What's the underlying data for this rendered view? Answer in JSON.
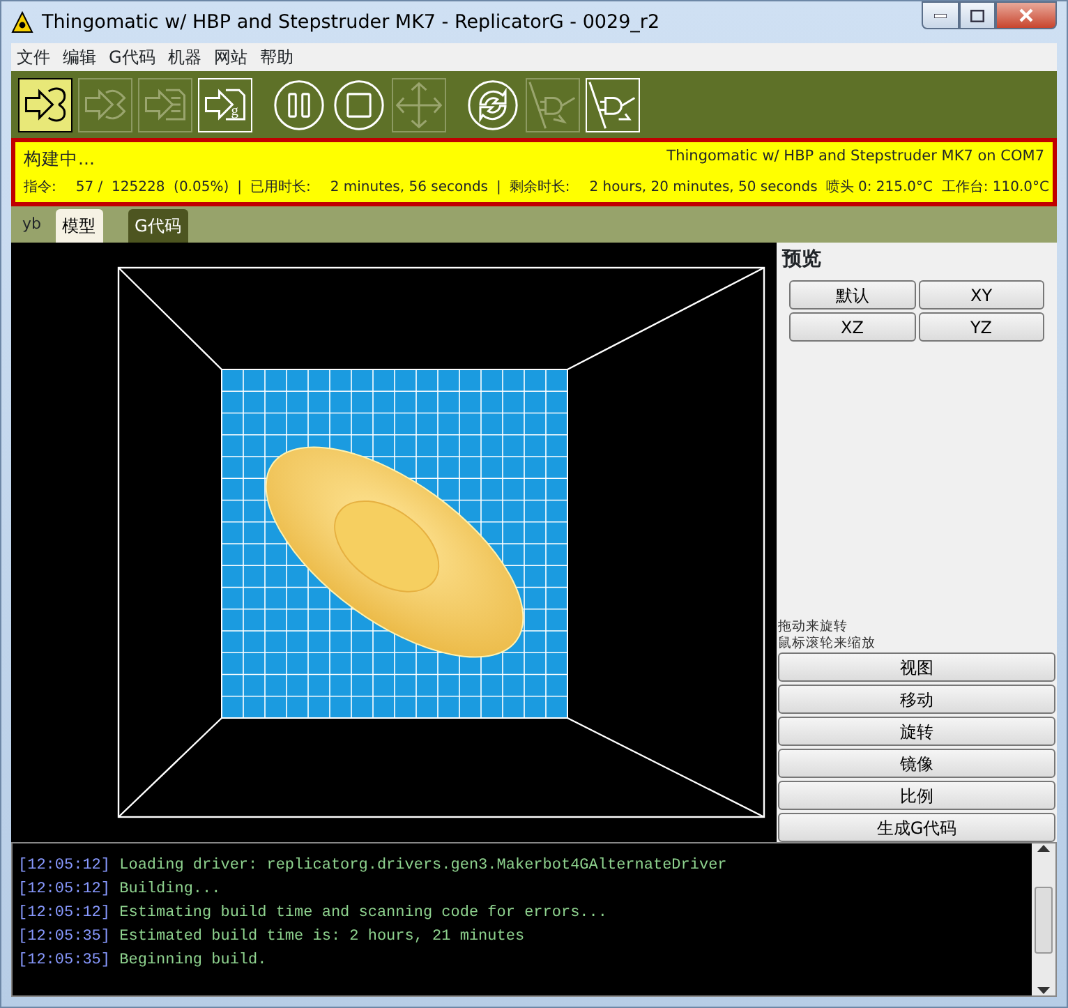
{
  "window": {
    "title": "Thingomatic w/ HBP and Stepstruder MK7 - ReplicatorG - 0029_r2"
  },
  "menu": [
    "文件",
    "编辑",
    "G代码",
    "机器",
    "网站",
    "帮助"
  ],
  "toolbar": [
    {
      "kind": "build",
      "active": true,
      "disabled": false
    },
    {
      "kind": "build-sd",
      "active": false,
      "disabled": true
    },
    {
      "kind": "build-file",
      "active": false,
      "disabled": true
    },
    {
      "kind": "build-gcode",
      "glyph": "g",
      "active": false,
      "disabled": false
    },
    {
      "kind": "pause",
      "active": false,
      "disabled": false
    },
    {
      "kind": "stop",
      "active": false,
      "disabled": false
    },
    {
      "kind": "jog",
      "active": false,
      "disabled": true
    },
    {
      "kind": "reset",
      "active": false,
      "disabled": false
    },
    {
      "kind": "disconnect",
      "active": false,
      "disabled": true
    },
    {
      "kind": "connect",
      "active": false,
      "disabled": false
    }
  ],
  "status": {
    "state": "构建中...",
    "machine": "Thingomatic w/ HBP and Stepstruder MK7 on COM7",
    "fields": [
      {
        "kind": "label",
        "text": "指令:"
      },
      {
        "kind": "value",
        "text": "57 /  125228  (0.05%)"
      },
      {
        "kind": "sep",
        "text": "|"
      },
      {
        "kind": "label",
        "text": "已用时长:"
      },
      {
        "kind": "value",
        "text": "2 minutes, 56 seconds"
      },
      {
        "kind": "sep",
        "text": "|"
      },
      {
        "kind": "label",
        "text": "剩余时长:"
      },
      {
        "kind": "value",
        "text": "2 hours, 20 minutes, 50 seconds"
      }
    ],
    "temps": "喷头 0: 215.0°C  工作台: 110.0°C"
  },
  "machine_tag": "yb",
  "tabs": [
    {
      "label": "模型",
      "selected": true
    },
    {
      "label": "G代码",
      "selected": false
    }
  ],
  "preview": {
    "title": "预览",
    "view_buttons": [
      "默认",
      "XY",
      "XZ",
      "YZ"
    ],
    "hints": [
      "拖动来旋转",
      "鼠标滚轮来缩放"
    ],
    "actions": [
      "视图",
      "移动",
      "旋转",
      "镜像",
      "比例",
      "生成G代码"
    ]
  },
  "log": [
    {
      "time": "[12:05:12]",
      "text": "Loading driver: replicatorg.drivers.gen3.Makerbot4GAlternateDriver"
    },
    {
      "time": "[12:05:12]",
      "text": "Building..."
    },
    {
      "time": "[12:05:12]",
      "text": "Estimating build time and scanning code for errors..."
    },
    {
      "time": "[12:05:35]",
      "text": "Estimated build time is: 2 hours, 21 minutes"
    },
    {
      "time": "[12:05:35]",
      "text": "Beginning build."
    }
  ]
}
